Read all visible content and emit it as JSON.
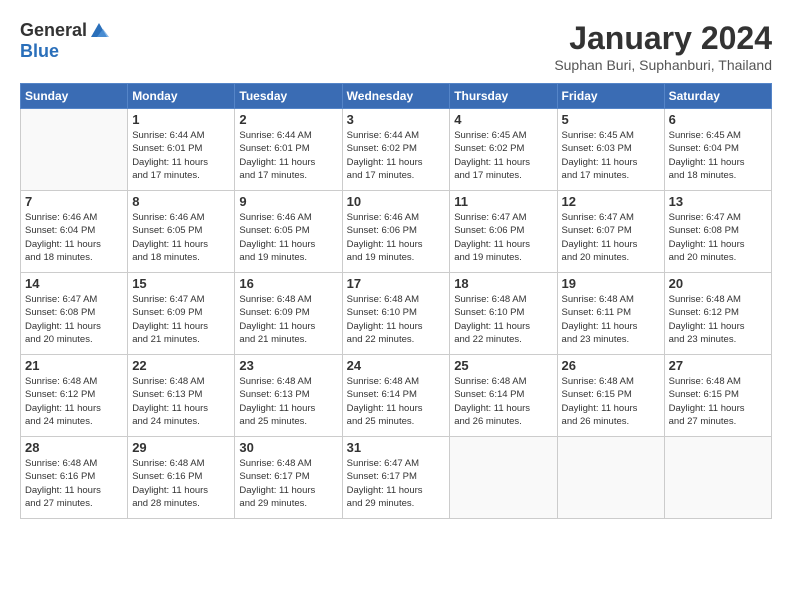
{
  "logo": {
    "general": "General",
    "blue": "Blue"
  },
  "title": "January 2024",
  "location": "Suphan Buri, Suphanburi, Thailand",
  "weekdays": [
    "Sunday",
    "Monday",
    "Tuesday",
    "Wednesday",
    "Thursday",
    "Friday",
    "Saturday"
  ],
  "weeks": [
    [
      {
        "day": "",
        "info": ""
      },
      {
        "day": "1",
        "info": "Sunrise: 6:44 AM\nSunset: 6:01 PM\nDaylight: 11 hours\nand 17 minutes."
      },
      {
        "day": "2",
        "info": "Sunrise: 6:44 AM\nSunset: 6:01 PM\nDaylight: 11 hours\nand 17 minutes."
      },
      {
        "day": "3",
        "info": "Sunrise: 6:44 AM\nSunset: 6:02 PM\nDaylight: 11 hours\nand 17 minutes."
      },
      {
        "day": "4",
        "info": "Sunrise: 6:45 AM\nSunset: 6:02 PM\nDaylight: 11 hours\nand 17 minutes."
      },
      {
        "day": "5",
        "info": "Sunrise: 6:45 AM\nSunset: 6:03 PM\nDaylight: 11 hours\nand 17 minutes."
      },
      {
        "day": "6",
        "info": "Sunrise: 6:45 AM\nSunset: 6:04 PM\nDaylight: 11 hours\nand 18 minutes."
      }
    ],
    [
      {
        "day": "7",
        "info": "Sunrise: 6:46 AM\nSunset: 6:04 PM\nDaylight: 11 hours\nand 18 minutes."
      },
      {
        "day": "8",
        "info": "Sunrise: 6:46 AM\nSunset: 6:05 PM\nDaylight: 11 hours\nand 18 minutes."
      },
      {
        "day": "9",
        "info": "Sunrise: 6:46 AM\nSunset: 6:05 PM\nDaylight: 11 hours\nand 19 minutes."
      },
      {
        "day": "10",
        "info": "Sunrise: 6:46 AM\nSunset: 6:06 PM\nDaylight: 11 hours\nand 19 minutes."
      },
      {
        "day": "11",
        "info": "Sunrise: 6:47 AM\nSunset: 6:06 PM\nDaylight: 11 hours\nand 19 minutes."
      },
      {
        "day": "12",
        "info": "Sunrise: 6:47 AM\nSunset: 6:07 PM\nDaylight: 11 hours\nand 20 minutes."
      },
      {
        "day": "13",
        "info": "Sunrise: 6:47 AM\nSunset: 6:08 PM\nDaylight: 11 hours\nand 20 minutes."
      }
    ],
    [
      {
        "day": "14",
        "info": "Sunrise: 6:47 AM\nSunset: 6:08 PM\nDaylight: 11 hours\nand 20 minutes."
      },
      {
        "day": "15",
        "info": "Sunrise: 6:47 AM\nSunset: 6:09 PM\nDaylight: 11 hours\nand 21 minutes."
      },
      {
        "day": "16",
        "info": "Sunrise: 6:48 AM\nSunset: 6:09 PM\nDaylight: 11 hours\nand 21 minutes."
      },
      {
        "day": "17",
        "info": "Sunrise: 6:48 AM\nSunset: 6:10 PM\nDaylight: 11 hours\nand 22 minutes."
      },
      {
        "day": "18",
        "info": "Sunrise: 6:48 AM\nSunset: 6:10 PM\nDaylight: 11 hours\nand 22 minutes."
      },
      {
        "day": "19",
        "info": "Sunrise: 6:48 AM\nSunset: 6:11 PM\nDaylight: 11 hours\nand 23 minutes."
      },
      {
        "day": "20",
        "info": "Sunrise: 6:48 AM\nSunset: 6:12 PM\nDaylight: 11 hours\nand 23 minutes."
      }
    ],
    [
      {
        "day": "21",
        "info": "Sunrise: 6:48 AM\nSunset: 6:12 PM\nDaylight: 11 hours\nand 24 minutes."
      },
      {
        "day": "22",
        "info": "Sunrise: 6:48 AM\nSunset: 6:13 PM\nDaylight: 11 hours\nand 24 minutes."
      },
      {
        "day": "23",
        "info": "Sunrise: 6:48 AM\nSunset: 6:13 PM\nDaylight: 11 hours\nand 25 minutes."
      },
      {
        "day": "24",
        "info": "Sunrise: 6:48 AM\nSunset: 6:14 PM\nDaylight: 11 hours\nand 25 minutes."
      },
      {
        "day": "25",
        "info": "Sunrise: 6:48 AM\nSunset: 6:14 PM\nDaylight: 11 hours\nand 26 minutes."
      },
      {
        "day": "26",
        "info": "Sunrise: 6:48 AM\nSunset: 6:15 PM\nDaylight: 11 hours\nand 26 minutes."
      },
      {
        "day": "27",
        "info": "Sunrise: 6:48 AM\nSunset: 6:15 PM\nDaylight: 11 hours\nand 27 minutes."
      }
    ],
    [
      {
        "day": "28",
        "info": "Sunrise: 6:48 AM\nSunset: 6:16 PM\nDaylight: 11 hours\nand 27 minutes."
      },
      {
        "day": "29",
        "info": "Sunrise: 6:48 AM\nSunset: 6:16 PM\nDaylight: 11 hours\nand 28 minutes."
      },
      {
        "day": "30",
        "info": "Sunrise: 6:48 AM\nSunset: 6:17 PM\nDaylight: 11 hours\nand 29 minutes."
      },
      {
        "day": "31",
        "info": "Sunrise: 6:47 AM\nSunset: 6:17 PM\nDaylight: 11 hours\nand 29 minutes."
      },
      {
        "day": "",
        "info": ""
      },
      {
        "day": "",
        "info": ""
      },
      {
        "day": "",
        "info": ""
      }
    ]
  ]
}
